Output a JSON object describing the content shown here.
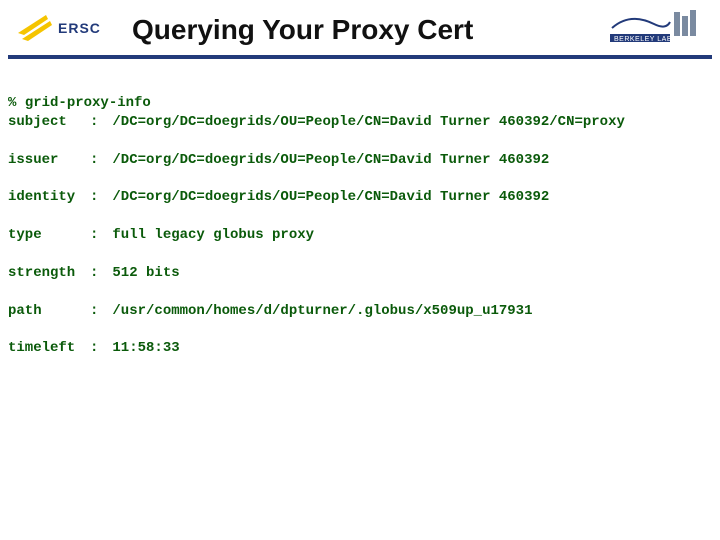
{
  "header": {
    "title": "Querying Your Proxy Cert",
    "logo_left_label": "NERSC",
    "logo_right_label": "Berkeley Lab"
  },
  "terminal": {
    "prompt": "%",
    "command": "grid-proxy-info",
    "separator": ":",
    "rows": [
      {
        "key": "subject",
        "value": "/DC=org/DC=doegrids/OU=People/CN=David Turner 460392/CN=proxy"
      },
      {
        "key": "issuer",
        "value": "/DC=org/DC=doegrids/OU=People/CN=David Turner 460392"
      },
      {
        "key": "identity",
        "value": "/DC=org/DC=doegrids/OU=People/CN=David Turner 460392"
      },
      {
        "key": "type",
        "value": "full legacy globus proxy"
      },
      {
        "key": "strength",
        "value": "512 bits"
      },
      {
        "key": "path",
        "value": "/usr/common/homes/d/dpturner/.globus/x509up_u17931"
      },
      {
        "key": "timeleft",
        "value": "11:58:33"
      }
    ]
  }
}
